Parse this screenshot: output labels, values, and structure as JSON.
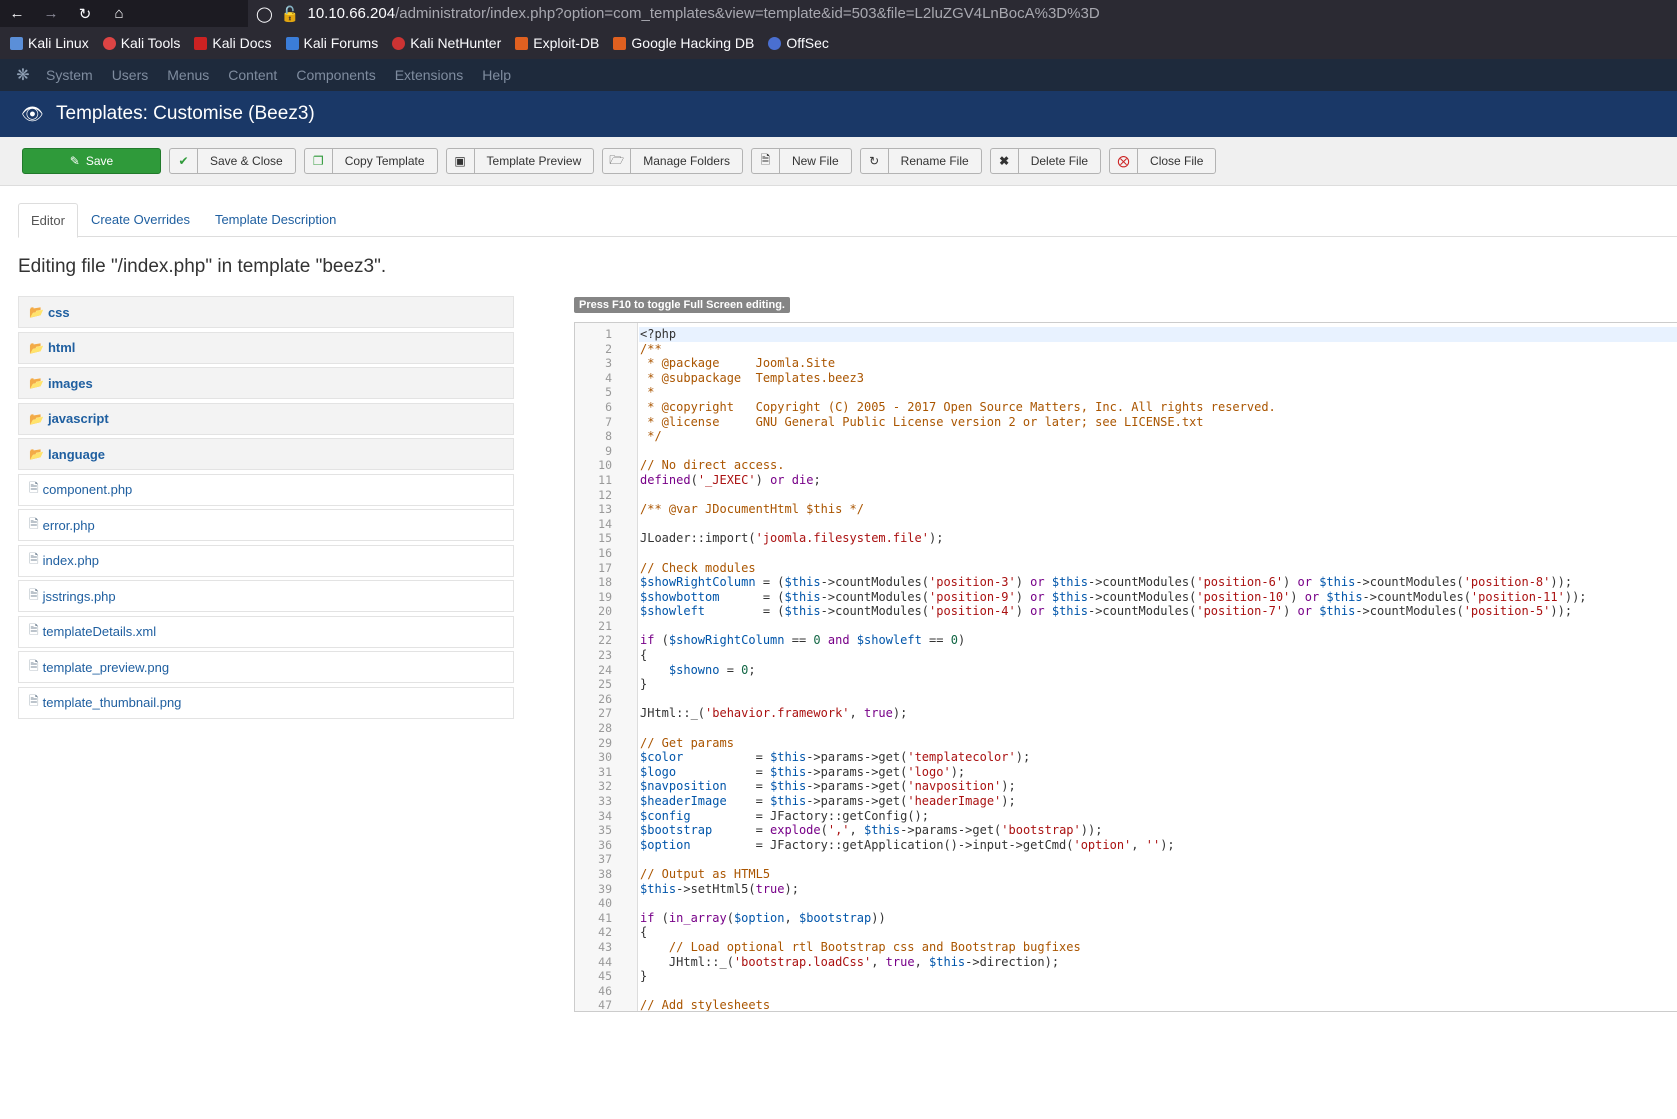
{
  "browser": {
    "url_host": "10.10.66.204",
    "url_path": "/administrator/index.php?option=com_templates&view=template&id=503&file=L2luZGV4LnBocA%3D%3D"
  },
  "bookmarks": [
    "Kali Linux",
    "Kali Tools",
    "Kali Docs",
    "Kali Forums",
    "Kali NetHunter",
    "Exploit-DB",
    "Google Hacking DB",
    "OffSec"
  ],
  "admin_menu": [
    "System",
    "Users",
    "Menus",
    "Content",
    "Components",
    "Extensions",
    "Help"
  ],
  "header": {
    "title": "Templates: Customise (Beez3)"
  },
  "toolbar": {
    "save": "Save",
    "save_close": "Save & Close",
    "copy_template": "Copy Template",
    "template_preview": "Template Preview",
    "manage_folders": "Manage Folders",
    "new_file": "New File",
    "rename_file": "Rename File",
    "delete_file": "Delete File",
    "close_file": "Close File"
  },
  "tabs": [
    "Editor",
    "Create Overrides",
    "Template Description"
  ],
  "page_title": "Editing file \"/index.php\" in template \"beez3\".",
  "folders": [
    "css",
    "html",
    "images",
    "javascript",
    "language"
  ],
  "files": [
    "component.php",
    "error.php",
    "index.php",
    "jsstrings.php",
    "templateDetails.xml",
    "template_preview.png",
    "template_thumbnail.png"
  ],
  "editor_hint": "Press F10 to toggle Full Screen editing.",
  "code_lines": [
    "<?php",
    "/**",
    " * @package     Joomla.Site",
    " * @subpackage  Templates.beez3",
    " *",
    " * @copyright   Copyright (C) 2005 - 2017 Open Source Matters, Inc. All rights reserved.",
    " * @license     GNU General Public License version 2 or later; see LICENSE.txt",
    " */",
    "",
    "// No direct access.",
    "defined('_JEXEC') or die;",
    "",
    "/** @var JDocumentHtml $this */",
    "",
    "JLoader::import('joomla.filesystem.file');",
    "",
    "// Check modules",
    "$showRightColumn = ($this->countModules('position-3') or $this->countModules('position-6') or $this->countModules('position-8'));",
    "$showbottom      = ($this->countModules('position-9') or $this->countModules('position-10') or $this->countModules('position-11'));",
    "$showleft        = ($this->countModules('position-4') or $this->countModules('position-7') or $this->countModules('position-5'));",
    "",
    "if ($showRightColumn == 0 and $showleft == 0)",
    "{",
    "    $showno = 0;",
    "}",
    "",
    "JHtml::_('behavior.framework', true);",
    "",
    "// Get params",
    "$color          = $this->params->get('templatecolor');",
    "$logo           = $this->params->get('logo');",
    "$navposition    = $this->params->get('navposition');",
    "$headerImage    = $this->params->get('headerImage');",
    "$config         = JFactory::getConfig();",
    "$bootstrap      = explode(',', $this->params->get('bootstrap'));",
    "$option         = JFactory::getApplication()->input->getCmd('option', '');",
    "",
    "// Output as HTML5",
    "$this->setHtml5(true);",
    "",
    "if (in_array($option, $bootstrap))",
    "{",
    "    // Load optional rtl Bootstrap css and Bootstrap bugfixes",
    "    JHtml::_('bootstrap.loadCss', true, $this->direction);",
    "}",
    "",
    "// Add stylesheets"
  ]
}
